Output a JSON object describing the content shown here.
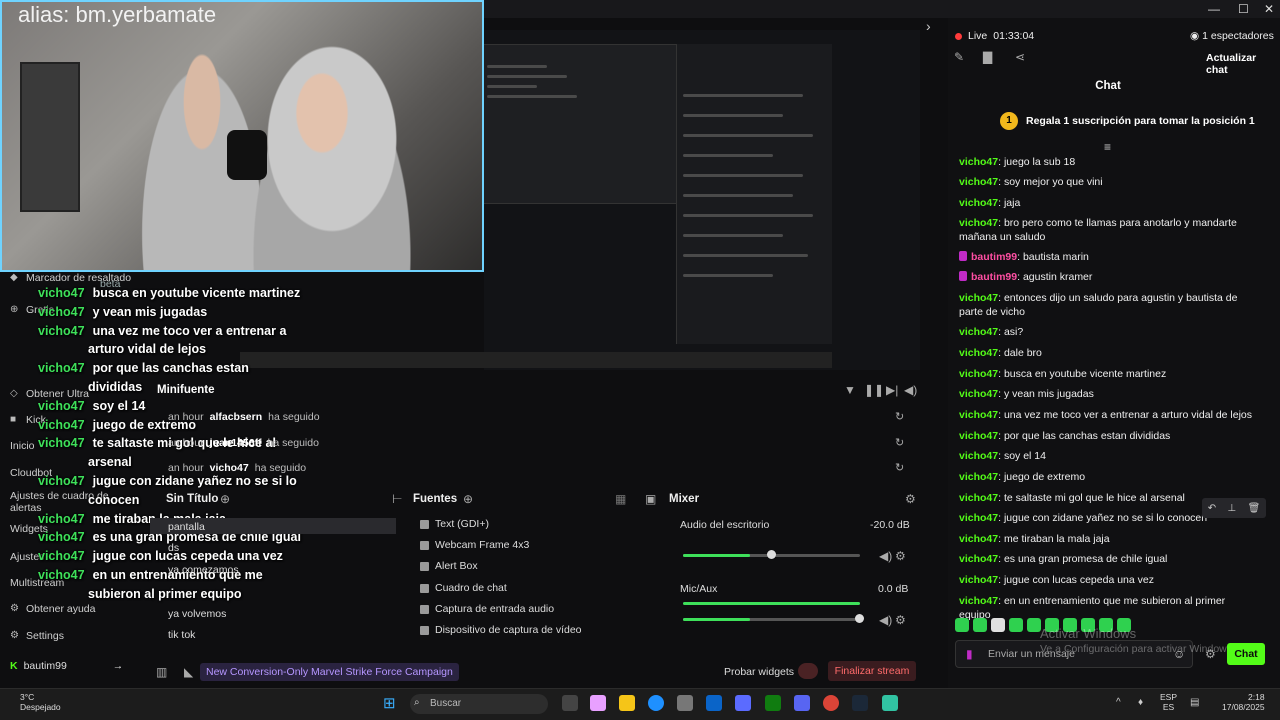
{
  "window": {
    "minimize": "—",
    "maximize": "☐",
    "close": "✕",
    "collapse": "›"
  },
  "webcam": {
    "alias": "alias: bm.yerbamate"
  },
  "overlay_chat": [
    {
      "user": "vicho47",
      "text": "busca en youtube vicente martinez"
    },
    {
      "user": "vicho47",
      "text": "y vean mis jugadas"
    },
    {
      "user": "vicho47",
      "text": "una vez me toco ver a entrenar a"
    },
    {
      "user": "",
      "text": "arturo vidal de lejos"
    },
    {
      "user": "vicho47",
      "text": "por que las canchas estan"
    },
    {
      "user": "",
      "text": "divididas"
    },
    {
      "user": "vicho47",
      "text": "soy el 14"
    },
    {
      "user": "vicho47",
      "text": "juego de extremo"
    },
    {
      "user": "vicho47",
      "text": "te saltaste mi gol que le hice al"
    },
    {
      "user": "",
      "text": "arsenal"
    },
    {
      "user": "vicho47",
      "text": "jugue con zidane yañez no se si lo"
    },
    {
      "user": "",
      "text": "conocen"
    },
    {
      "user": "vicho47",
      "text": "me tiraban la mala jaja"
    },
    {
      "user": "vicho47",
      "text": "es una gran promesa de chile igual"
    },
    {
      "user": "vicho47",
      "text": "jugue con lucas cepeda una vez"
    },
    {
      "user": "vicho47",
      "text": "en un entrenamiento que me"
    },
    {
      "user": "",
      "text": "subieron al primer equipo"
    }
  ],
  "leftnav": {
    "items": [
      {
        "label": "Marcador de resaltado",
        "badge": "beta"
      },
      {
        "label": "Gratis"
      },
      {
        "label": "Obtener Ultra"
      },
      {
        "label": "Kick"
      },
      {
        "label": "Inicio"
      },
      {
        "label": "Cloudbot"
      },
      {
        "label": "Ajustes de cuadro de alertas"
      },
      {
        "label": "Widgets"
      },
      {
        "label": "Ajustes"
      },
      {
        "label": "Multistream"
      },
      {
        "label": "Obtener ayuda"
      },
      {
        "label": "Settings"
      }
    ],
    "user": "bautim99"
  },
  "feed": {
    "title": "Minifuente",
    "rows": [
      {
        "time": "an hour",
        "user": "alfacbsern",
        "action": "ha seguido"
      },
      {
        "time": "an hour",
        "user": "juan1456ff",
        "action": "ha seguido"
      },
      {
        "time": "an hour",
        "user": "vicho47",
        "action": "ha seguido"
      }
    ]
  },
  "scenes": {
    "title": "Sin Título",
    "items": [
      "pantalla",
      "ds",
      "ya comezamos",
      "ya volvemos",
      "tik tok"
    ]
  },
  "sources": {
    "title": "Fuentes",
    "items": [
      "Text (GDI+)",
      "Webcam Frame 4x3",
      "Alert Box",
      "Cuadro de chat",
      "Captura de entrada audio",
      "Dispositivo de captura de vídeo"
    ]
  },
  "mixer": {
    "title": "Mixer",
    "tracks": [
      {
        "label": "Audio del escritorio",
        "db": "-20.0 dB",
        "level": 0.5
      },
      {
        "label": "Mic/Aux",
        "db": "0.0 dB",
        "level": 1.0
      }
    ]
  },
  "statusbar": {
    "campaign": "New Conversion-Only Marvel Strike Force Campaign",
    "probar": "Probar widgets",
    "end": "Finalizar stream"
  },
  "rightchat": {
    "live_label": "Live",
    "live_time": "01:33:04",
    "viewers": "1 espectadores",
    "update": "Actualizar chat",
    "title": "Chat",
    "gift_badge": "1",
    "gift_text": "Regala 1 suscripción para tomar la posición 1",
    "messages": [
      {
        "user": "vicho47",
        "text": "juego la sub 18"
      },
      {
        "user": "vicho47",
        "text": "soy mejor yo que vini"
      },
      {
        "user": "vicho47",
        "text": "jaja"
      },
      {
        "user": "vicho47",
        "text": "bro pero como te llamas para anotarlo y mandarte mañana un saludo"
      },
      {
        "user": "bautim99",
        "text": "bautista marin",
        "pink": true
      },
      {
        "user": "bautim99",
        "text": "agustin kramer",
        "pink": true
      },
      {
        "user": "vicho47",
        "text": "entonces dijo un saludo para agustin y bautista de parte de vicho"
      },
      {
        "user": "vicho47",
        "text": "asi?"
      },
      {
        "user": "vicho47",
        "text": "dale bro"
      },
      {
        "user": "vicho47",
        "text": "busca en youtube vicente martinez"
      },
      {
        "user": "vicho47",
        "text": "y vean mis jugadas"
      },
      {
        "user": "vicho47",
        "text": "una vez me toco ver a entrenar a arturo vidal de lejos"
      },
      {
        "user": "vicho47",
        "text": "por que las canchas estan divididas"
      },
      {
        "user": "vicho47",
        "text": "soy el 14"
      },
      {
        "user": "vicho47",
        "text": "juego de extremo"
      },
      {
        "user": "vicho47",
        "text": "te saltaste mi gol que le hice al arsenal"
      },
      {
        "user": "vicho47",
        "text": "jugue con zidane yañez no se si lo conocen"
      },
      {
        "user": "vicho47",
        "text": "me tiraban la mala jaja"
      },
      {
        "user": "vicho47",
        "text": "es una gran promesa de chile igual"
      },
      {
        "user": "vicho47",
        "text": "jugue con lucas cepeda una vez"
      },
      {
        "user": "vicho47",
        "text": "en un entrenamiento que me subieron al primer equipo"
      }
    ],
    "input_placeholder": "Enviar un mensaje",
    "send": "Chat",
    "watermark_title": "Activar Windows",
    "watermark_sub": "Ve a Configuración para activar Windows."
  },
  "taskbar": {
    "weather_temp": "3°C",
    "weather_desc": "Despejado",
    "search": "Buscar",
    "lang1": "ESP",
    "lang2": "ES",
    "time": "2:18",
    "date": "17/08/2025"
  }
}
